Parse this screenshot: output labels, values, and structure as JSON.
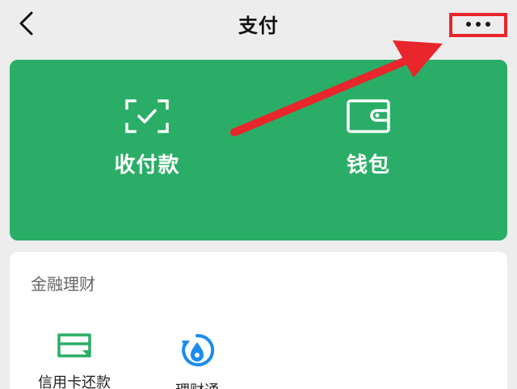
{
  "header": {
    "title": "支付",
    "back_icon": "chevron-left-icon",
    "more_icon": "more-horizontal-icon"
  },
  "actions": [
    {
      "label": "收付款",
      "icon": "scan-check-icon"
    },
    {
      "label": "钱包",
      "icon": "wallet-icon"
    }
  ],
  "finance": {
    "title": "金融理财",
    "services": [
      {
        "label": "信用卡还款",
        "icon": "credit-card-icon"
      },
      {
        "label": "理财通",
        "icon": "wealth-icon"
      }
    ]
  },
  "colors": {
    "background": "#ededed",
    "card_green": "#2aae67",
    "annotation_red": "#e8262b",
    "service_icon_green": "#2aae67",
    "service_icon_blue": "#1a8cf0"
  }
}
